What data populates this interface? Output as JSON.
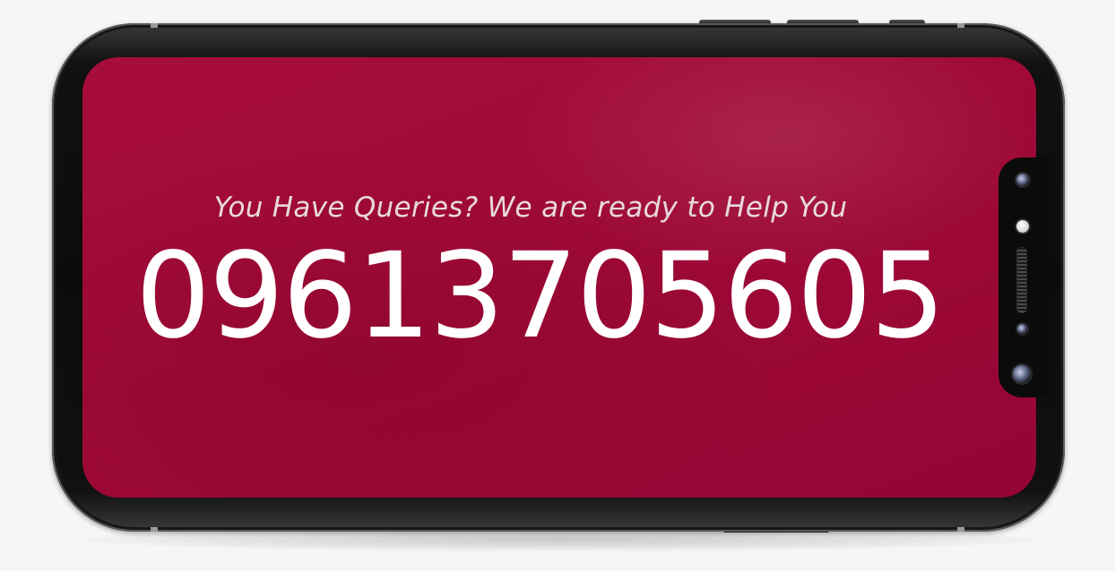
{
  "banner": {
    "tagline": "You Have Queries? We are ready to Help You",
    "phone_number": "09613705605"
  },
  "colors": {
    "screen_background": "#a00a37",
    "phone_body": "#0b0b0b",
    "tagline_text": "#e8d9de",
    "number_text": "#ffffff",
    "page_background": "#f6f6f6"
  },
  "icons": [
    "front-camera-icon",
    "proximity-sensor-icon",
    "earpiece-speaker-icon",
    "ambient-sensor-icon",
    "front-lens-icon"
  ]
}
